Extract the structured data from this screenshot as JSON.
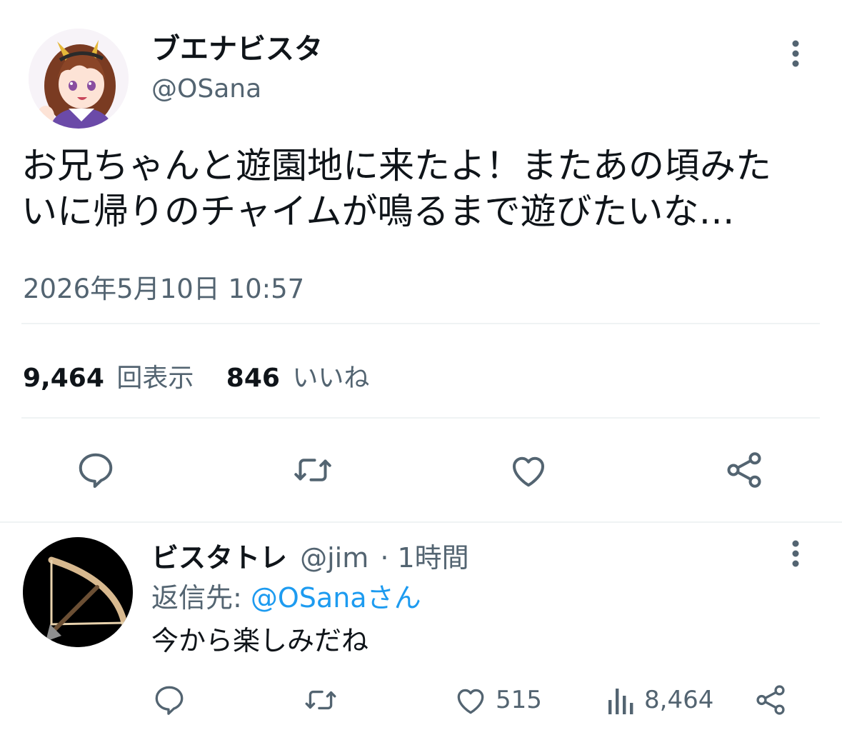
{
  "tweet": {
    "author": {
      "display_name": "ブエナビスタ",
      "handle": "@OSana"
    },
    "text_line1": "お兄ちゃんと遊園地に来たよ！またあの頃みた",
    "text_line2": "いに帰りのチャイムが鳴るまで遊びたいな…",
    "timestamp": "2026年5月10日 10:57",
    "stats": {
      "views_count": "9,464",
      "views_label": "回表示",
      "likes_count": "846",
      "likes_label": "いいね"
    }
  },
  "reply": {
    "author": {
      "display_name": "ビスタトレ",
      "handle": "@jim",
      "time": "· 1時間"
    },
    "replying_to_prefix": "返信先: ",
    "replying_to_handle": "@OSanaさん",
    "text": "今から楽しみだね",
    "likes": "515",
    "views": "8,464"
  },
  "icons": {
    "more": "more-vertical-icon",
    "reply": "reply-bubble-icon",
    "retweet": "retweet-icon",
    "like": "heart-icon",
    "share": "share-icon",
    "analytics": "analytics-bars-icon"
  },
  "colors": {
    "text": "#0f1419",
    "muted": "#536471",
    "link": "#1d9bf0",
    "divider": "#eff3f4"
  }
}
